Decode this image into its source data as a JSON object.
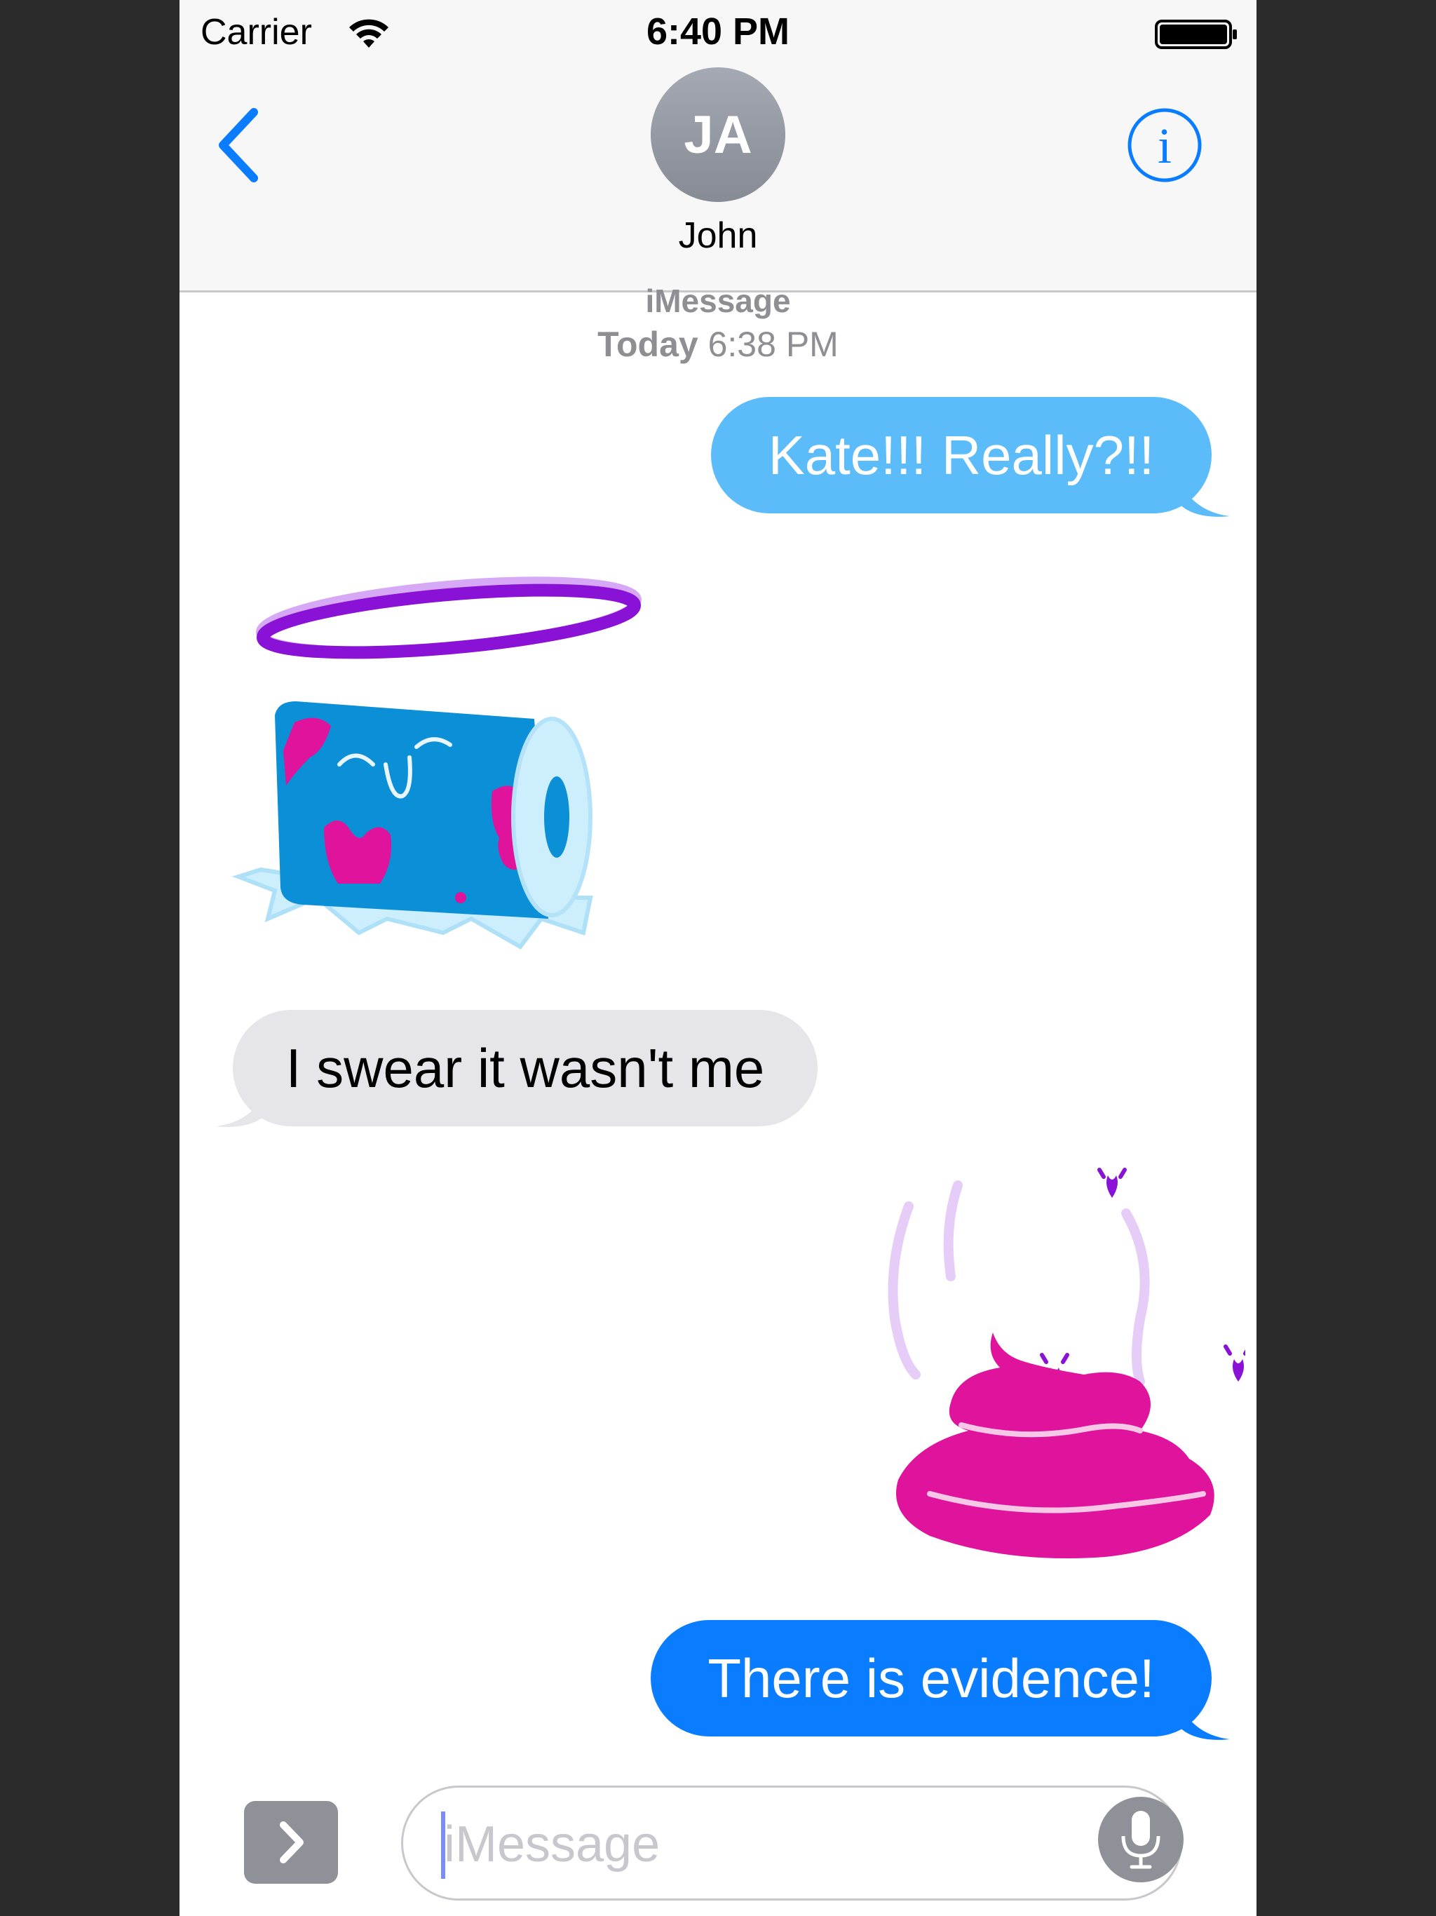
{
  "status_bar": {
    "carrier": "Carrier",
    "time": "6:40 PM"
  },
  "header": {
    "avatar_initials": "JA",
    "contact_name": "John",
    "back_icon": "chevron-left-icon",
    "info_icon": "info-circle-icon"
  },
  "conversation": {
    "service": "iMessage",
    "timestamp_day": "Today",
    "timestamp_time": "6:38 PM",
    "messages": [
      {
        "direction": "outgoing",
        "text": "Kate!!! Really?!!"
      },
      {
        "direction": "incoming",
        "sticker": "toilet-paper-halo-sticker"
      },
      {
        "direction": "incoming",
        "text": "I swear it wasn't me"
      },
      {
        "direction": "outgoing",
        "sticker": "poop-with-flies-sticker"
      },
      {
        "direction": "outgoing",
        "text": "There is evidence!"
      }
    ]
  },
  "input_bar": {
    "placeholder": "iMessage",
    "expand_icon": "chevron-right-icon",
    "mic_icon": "microphone-icon"
  },
  "colors": {
    "outgoing_light": "#5bbcf9",
    "outgoing_dark": "#0a7cff",
    "incoming": "#e5e5ea",
    "accent": "#0a7cff"
  }
}
